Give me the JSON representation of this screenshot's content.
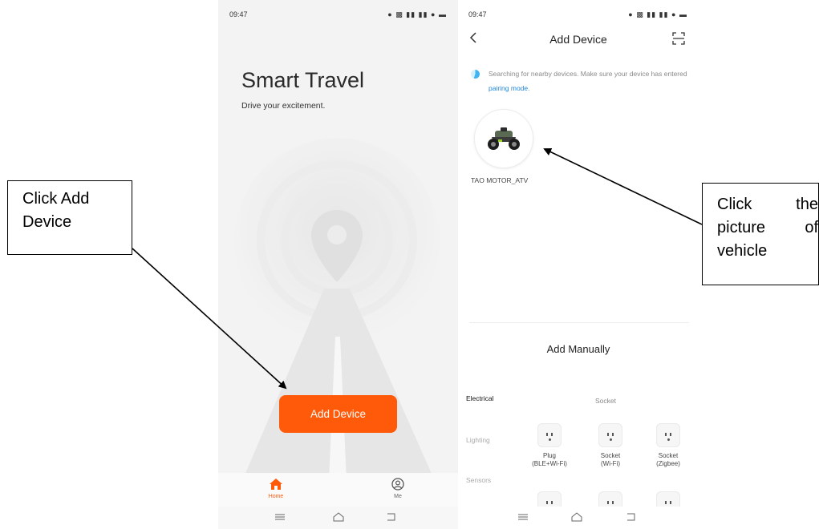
{
  "screen1": {
    "status_time": "09:47",
    "title": "Smart Travel",
    "subtitle": "Drive your excitement.",
    "add_button": "Add Device",
    "tabs": [
      {
        "label": "Home",
        "icon": "home-icon"
      },
      {
        "label": "Me",
        "icon": "user-icon"
      }
    ]
  },
  "screen2": {
    "status_time": "09:47",
    "title": "Add Device",
    "search_text": "Searching for nearby devices. Make sure your device has entered ",
    "search_link": "pairing mode",
    "search_suffix": ".",
    "device_name": "TAO MOTOR_ATV",
    "manual_title": "Add Manually",
    "categories": [
      "Electrical",
      "Lighting",
      "Sensors"
    ],
    "category_header": "Socket",
    "products": [
      {
        "line1": "Plug",
        "line2": "(BLE+Wi-Fi)"
      },
      {
        "line1": "Socket",
        "line2": "(Wi-Fi)"
      },
      {
        "line1": "Socket",
        "line2": "(Zigbee)"
      }
    ]
  },
  "callouts": {
    "left": "Click Add Device",
    "right": "Click the picture of vehicle"
  },
  "colors": {
    "accent": "#ff5a0a",
    "link": "#1f86d9",
    "spinner": "#3fb4f0"
  }
}
